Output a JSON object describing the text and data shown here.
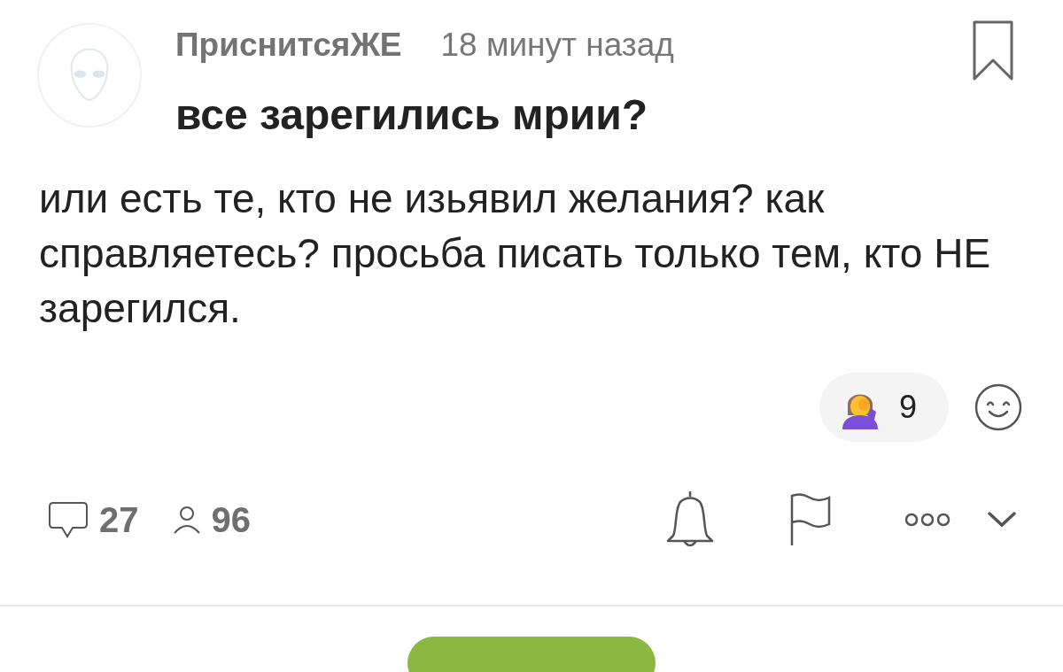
{
  "post": {
    "author": "ПриснитсяЖЕ",
    "time": "18 минут назад",
    "title": "все зарегились мрии?",
    "body": "или есть те, кто не изьявил желания? как справляетесь? просьба писать только тем, кто НЕ зарегился."
  },
  "reactions": [
    {
      "count": "9"
    }
  ],
  "footer": {
    "comments": "27",
    "viewers": "96"
  }
}
